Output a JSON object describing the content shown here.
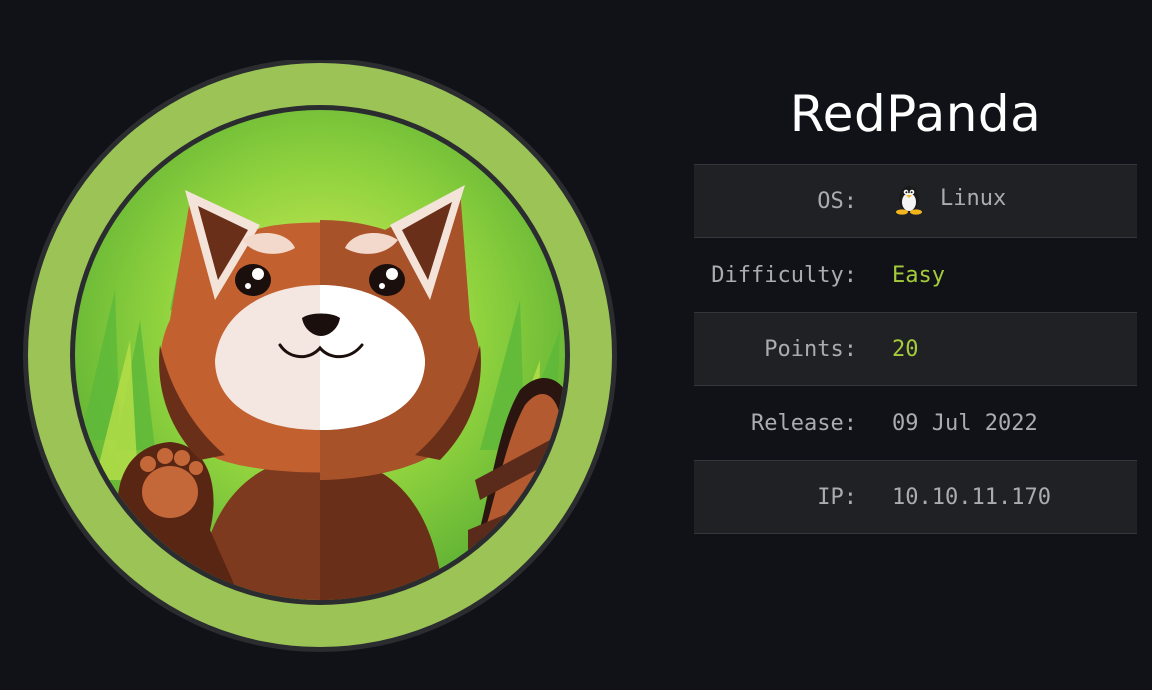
{
  "machine": {
    "name": "RedPanda"
  },
  "info": {
    "os_label": "OS:",
    "os_value": "Linux",
    "os_icon": "linux-tux-icon",
    "difficulty_label": "Difficulty:",
    "difficulty_value": "Easy",
    "points_label": "Points:",
    "points_value": "20",
    "release_label": "Release:",
    "release_value": "09 Jul 2022",
    "ip_label": "IP:",
    "ip_value": "10.10.11.170"
  },
  "colors": {
    "background": "#111217",
    "ring": "#9bc356",
    "accent_green": "#a4cc3a",
    "text_muted": "#a9acb1",
    "row_shade": "#1f2125"
  }
}
